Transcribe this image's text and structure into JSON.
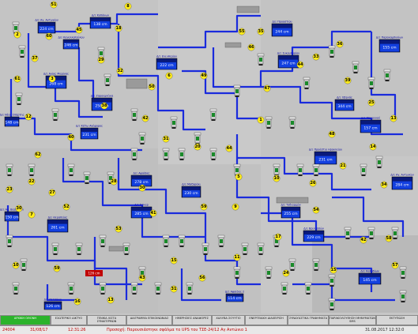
{
  "window": {
    "title": "Τηλεέλεγχος δικτύου ύδρευσης"
  },
  "tanks": [
    {
      "id": "t1",
      "value": "224 cm",
      "name": "Δ/Ξ Αγ. Αντωνίου"
    },
    {
      "id": "t2",
      "value": "138 cm",
      "name": "Δ/Ξ Κοπάνων"
    },
    {
      "id": "t3",
      "value": "246 cm",
      "name": "Δ/Ξ Κανελλοπούλου"
    },
    {
      "id": "t4",
      "value": "268 cm",
      "name": "Δ/Ξ Αγίας Μαρίνας"
    },
    {
      "id": "t5",
      "value": "222 cm",
      "name": "Δ/Ξ Ελευθερίου"
    },
    {
      "id": "t6",
      "value": "148 cm",
      "name": "Δ/Ξ Νέας Σπάρτης"
    },
    {
      "id": "t7",
      "value": "258 cm",
      "name": "Δ/Ξ Ζαρουχλέικα"
    },
    {
      "id": "t8",
      "value": "231 cm",
      "name": "Δ/Ξ Κάτω Ανήφορος"
    },
    {
      "id": "t9",
      "value": "278 cm",
      "name": "Δ/Ξ Αφαίδας"
    },
    {
      "id": "t10",
      "value": "285 cm",
      "name": "Δ/Ξ Άσκαρ"
    },
    {
      "id": "t11",
      "value": "244 cm",
      "name": "Δ/Ξ Προαστίου"
    },
    {
      "id": "t12",
      "value": "247 cm",
      "name": "Δ/Ξ Συκουλαρίου"
    },
    {
      "id": "t13",
      "value": "155 cm",
      "name": "Δ/Ξ Παρακαμπυλίων"
    },
    {
      "id": "t14",
      "value": "344 cm",
      "name": "Δ/Ξ Οβρυάς"
    },
    {
      "id": "t15",
      "value": "157 cm",
      "name": "Δ/Ξ Μακρυνού"
    },
    {
      "id": "t16",
      "value": "231 cm",
      "name": "Δ/Ξ Προάστιο Ηρακλείου"
    },
    {
      "id": "t17",
      "value": "230 cm",
      "name": "Δ/Ξ Μαζαράκι"
    },
    {
      "id": "t18",
      "value": "284 cm",
      "name": "Δ/Ξ Αγ. Αντωνίου"
    },
    {
      "id": "t19",
      "value": "150 cm",
      "name": "Δ/Ξ Αγ. Βασιλείου"
    },
    {
      "id": "t20",
      "value": "261 cm",
      "name": "Δ/Ξ Θεραπείας"
    },
    {
      "id": "t21",
      "value": "255 cm",
      "name": "Δ/Ξ Ταξιαρχών"
    },
    {
      "id": "t22",
      "value": "229 cm",
      "name": "Δ/Ξ Βριλησσών"
    },
    {
      "id": "t23",
      "value": "145 cm",
      "name": "Δ/Ξ Καλυβίων"
    },
    {
      "id": "t24",
      "value": "114 cm",
      "name": "Δ/Ξ Αφαίδας 2"
    },
    {
      "id": "t25",
      "value": "126 cm",
      "name": "Δ/Ξ Πετσάκοι"
    }
  ],
  "footer": {
    "buttons": [
      "ΑΡΧΙΚΗ ΟΘΟΝΗ",
      "ΕΣΩΤΕΡΙΚΟ ΔΙΚΤΥΟ",
      "ΓΕΝΙΚΑ ΛΙΣΤΑ ΣΥΝΑΓΕΡΜΩΝ",
      "ΔΙΑΓΡΑΜΜΑ ΕΠΙΚΟΙΝΩΝΙΑΣ",
      "ΗΜΕΡΗΣΙΕΣ ΑΝΑΦΟΡΕΣ",
      "ΧΑΛΥΒΑ ΣΟΥΥΤΙΟ",
      "ΕΝΕΡΓΕΙΑΚΗ ΔΙΑΧΕΙΡΙΣΗ",
      "ΣΥΝΔΥΑΣΤΙΚΑ ΓΡΑΦΗΜΑΤΑ",
      "ΠΑΡΑΚΟΛΟΥΘΗΣΗ ΜΗΝΥΜΑΤΩΝ SMS",
      "ΕΚΤΥΠΩΣΗ"
    ],
    "status": {
      "code": "24004",
      "date": "31/08/17",
      "time": "12:31:26",
      "message": "Προσοχή: Παρουσιάστηκε σφάλμα το UPS του ΤΣΕ-24/12 Αγ Αντώνιο 1",
      "timestamp": "31.08.2017 12:32:0"
    }
  },
  "colors": {
    "pipe": "#1a2bdc",
    "tank": "#0a1a7a",
    "water": "#1340e0",
    "background": "#c6c6c6",
    "alarm": "#c00000"
  }
}
